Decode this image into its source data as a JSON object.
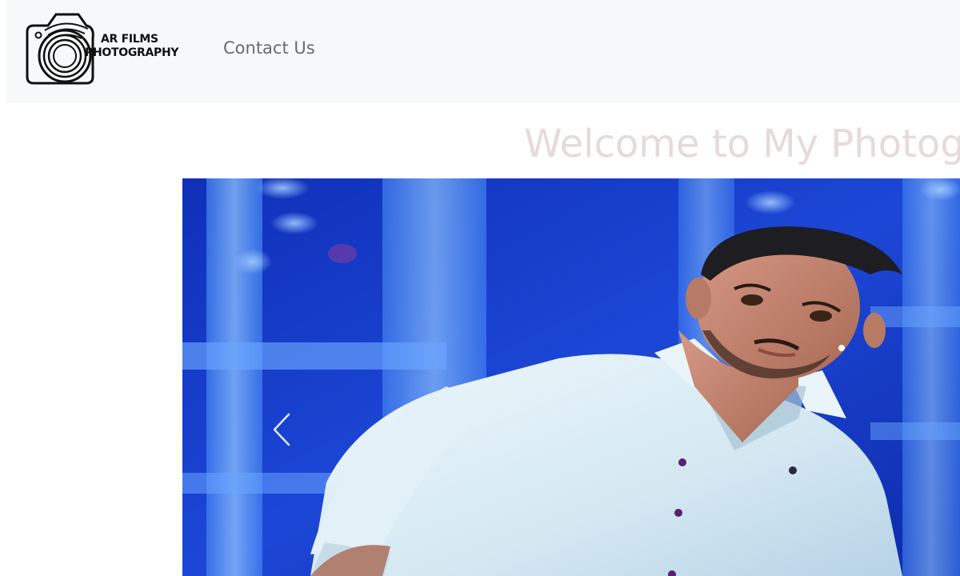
{
  "navbar": {
    "logo": {
      "line1": "AR FILMS",
      "line2": "PHOTOGRAPHY",
      "icon": "camera-icon"
    },
    "links": [
      {
        "label": "Contact Us"
      }
    ]
  },
  "hero": {
    "heading": "Welcome to My Photogr"
  },
  "carousel": {
    "slide_image": "portrait-photo",
    "prev_icon": "chevron-left-icon",
    "accent_color": "#1f4de0"
  }
}
